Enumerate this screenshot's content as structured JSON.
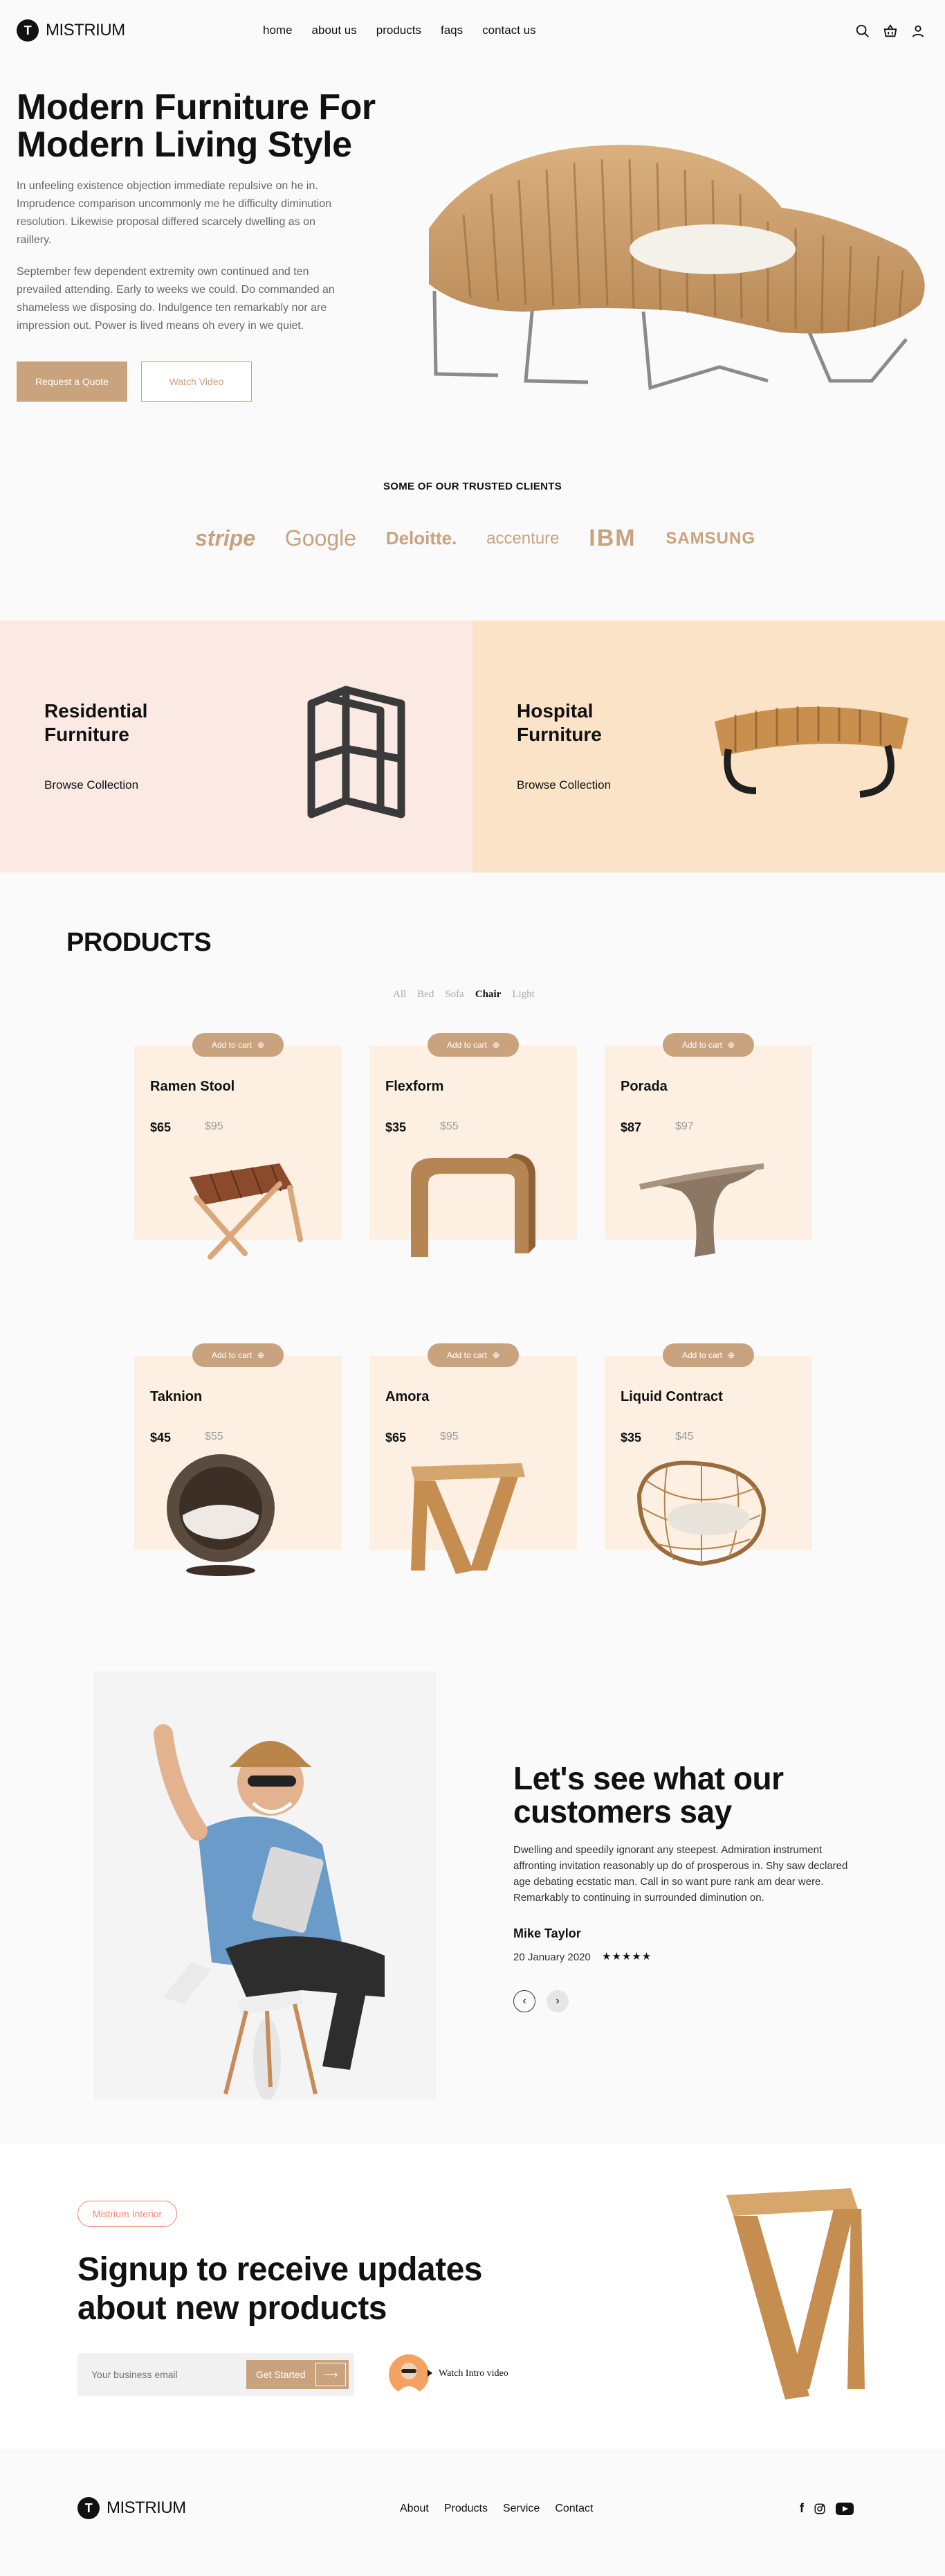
{
  "brand": {
    "name": "MISTRIUM",
    "mark": "T"
  },
  "nav": {
    "items": [
      "home",
      "about us",
      "products",
      "faqs",
      "contact us"
    ]
  },
  "header_icons": [
    "search-icon",
    "basket-icon",
    "user-icon"
  ],
  "hero": {
    "title_line1": "Modern Furniture For",
    "title_line2": "Modern Living Style",
    "para1": "In unfeeling existence objection immediate repulsive on he in. Imprudence comparison uncommonly me he difficulty diminution resolution. Likewise proposal differed scarcely dwelling as on raillery.",
    "para2": "September few dependent extremity own continued and ten prevailed attending. Early to weeks we could. Do commanded an shameless we disposing do. Indulgence ten remarkably nor are impression out. Power is lived means oh every in we quiet.",
    "btn_quote": "Request a Quote",
    "btn_video": "Watch Video"
  },
  "clients": {
    "title": "SOME OF OUR TRUSTED CLIENTS",
    "logos": [
      "stripe",
      "Google",
      "Deloitte.",
      "accenture",
      "IBM",
      "SAMSUNG"
    ]
  },
  "categories": [
    {
      "title_line1": "Residential",
      "title_line2": "Furniture",
      "link": "Browse Collection"
    },
    {
      "title_line1": "Hospital",
      "title_line2": "Furniture",
      "link": "Browse Collection"
    }
  ],
  "products": {
    "title": "PRODUCTS",
    "filters": [
      "All",
      "Bed",
      "Sofa",
      "Chair",
      "Light"
    ],
    "active_filter": "Chair",
    "add_to_cart": "Add to cart",
    "items": [
      {
        "name": "Ramen Stool",
        "price": "$65",
        "old": "$95"
      },
      {
        "name": "Flexform",
        "price": "$35",
        "old": "$55"
      },
      {
        "name": "Porada",
        "price": "$87",
        "old": "$97"
      },
      {
        "name": "Taknion",
        "price": "$45",
        "old": "$55"
      },
      {
        "name": "Amora",
        "price": "$65",
        "old": "$95"
      },
      {
        "name": "Liquid Contract",
        "price": "$35",
        "old": "$45"
      }
    ]
  },
  "testimonial": {
    "title_line1": "Let's see what our",
    "title_line2": "customers say",
    "text": "Dwelling and speedily ignorant any steepest. Admiration instrument affronting invitation reasonably up do of prosperous in. Shy saw declared age debating ecstatic man. Call in so want pure rank am dear were. Remarkably to continuing in surrounded diminution on.",
    "name": "Mike Taylor",
    "date": "20 January 2020",
    "stars": "★★★★★",
    "rating": 5
  },
  "signup": {
    "pill": "Mistrium Interior",
    "title_line1": "Signup to receive updates",
    "title_line2": "about new products",
    "placeholder": "Your business email",
    "btn": "Get Started",
    "video": "Watch Intro video"
  },
  "footer": {
    "links": [
      "About",
      "Products",
      "Service",
      "Contact"
    ],
    "social": [
      "facebook-icon",
      "instagram-icon",
      "youtube-icon"
    ]
  },
  "colors": {
    "accent": "#c9a27e",
    "cat_left_bg": "#fbeae4",
    "cat_right_bg": "#fbe3c8",
    "card_bg": "#fdf0e3",
    "pill": "#f08a6a"
  }
}
